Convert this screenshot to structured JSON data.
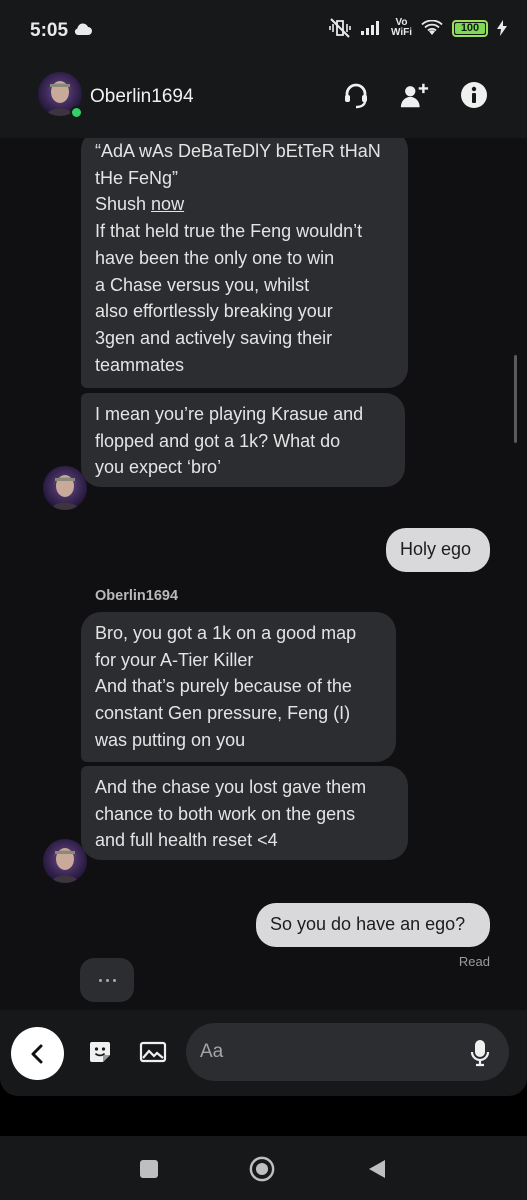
{
  "status_bar": {
    "time": "5:05",
    "volte_line1": "Vo",
    "volte_line2": "WiFi",
    "battery": "100"
  },
  "header": {
    "contact_name": "Oberlin1694",
    "online": true,
    "icons": [
      "call-headset-icon",
      "add-person-icon",
      "info-icon"
    ]
  },
  "messages": [
    {
      "direction": "in",
      "text": "“AdA wAs DeBaTeDlY bEtTeR tHaN\ntHe FeNg”\nShush ",
      "text_link": "now",
      "text_rest": "\nIf that held true the Feng wouldn’t\nhave been the only one to win\na Chase versus you, whilst\nalso effortlessly breaking your\n3gen and actively saving their\nteammates"
    },
    {
      "direction": "in",
      "text": "I mean you’re playing Krasue and\nflopped and got a 1k? What do\nyou expect ‘bro’"
    },
    {
      "direction": "out",
      "text": "Holy ego"
    },
    {
      "direction": "in",
      "text": "Bro, you got a 1k on a good map\nfor your A-Tier Killer\nAnd that’s purely because of the\nconstant Gen pressure, Feng (I)\nwas putting on you"
    },
    {
      "direction": "in",
      "text": "And the chase you lost gave them\nchance to both work on the gens\nand full health reset <4"
    },
    {
      "direction": "out",
      "text": "So you do have an ego?"
    }
  ],
  "sender_label": "Oberlin1694",
  "read_receipt": "Read",
  "typing_indicator": "···",
  "composer": {
    "placeholder": "Aa",
    "icons": [
      "back-icon",
      "sticker-icon",
      "image-icon",
      "microphone-icon"
    ]
  },
  "nav_bar": {
    "icons": [
      "recents-square-icon",
      "home-circle-icon",
      "back-triangle-icon"
    ]
  },
  "colors": {
    "background": "#101012",
    "incoming_bubble": "#2c2d30",
    "outgoing_bubble": "#d9d9dc",
    "online_dot": "#31d068",
    "battery": "#7ed957"
  }
}
